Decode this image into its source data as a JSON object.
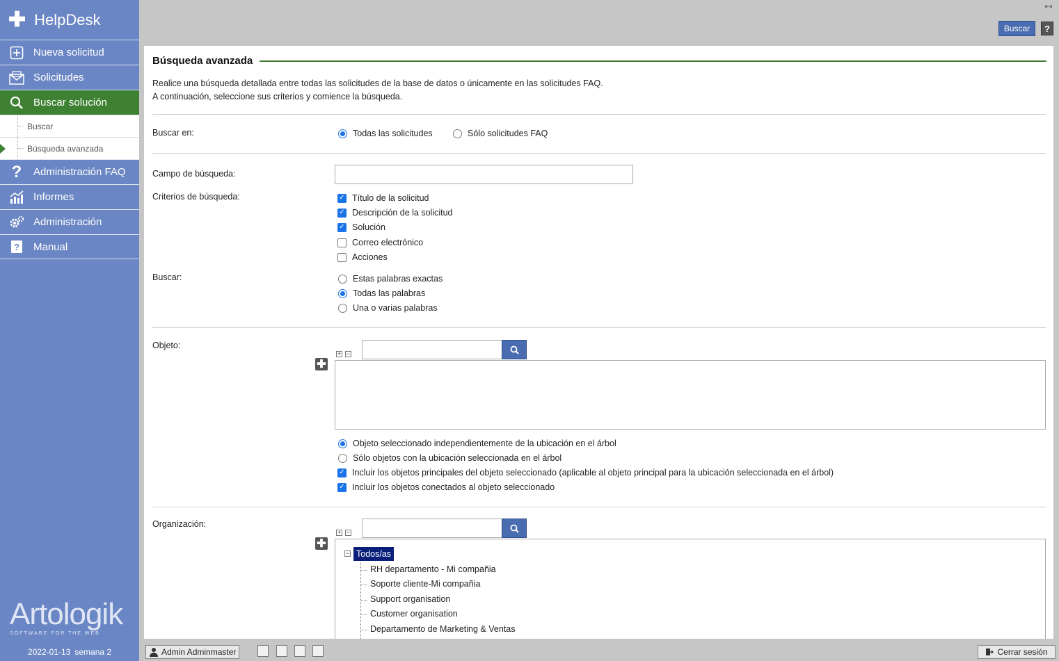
{
  "app": {
    "title": "HelpDesk"
  },
  "sidebar": {
    "items": [
      {
        "label": "Nueva solicitud",
        "icon": "plus-square-icon"
      },
      {
        "label": "Solicitudes",
        "icon": "envelope-icon"
      },
      {
        "label": "Buscar solución",
        "icon": "search-icon",
        "active": true
      },
      {
        "label": "Administración FAQ",
        "icon": "question-icon"
      },
      {
        "label": "Informes",
        "icon": "chart-icon"
      },
      {
        "label": "Administración",
        "icon": "gears-icon"
      },
      {
        "label": "Manual",
        "icon": "manual-icon"
      }
    ],
    "subitems": [
      {
        "label": "Buscar"
      },
      {
        "label": "Búsqueda avanzada",
        "active": true
      }
    ],
    "brand": "Artologik",
    "brand_sub": "SOFTWARE FOR THE WEB",
    "date": "2022-01-13",
    "week": "semana 2"
  },
  "topbar": {
    "search_button": "Buscar",
    "help": "?"
  },
  "page": {
    "title": "Búsqueda avanzada",
    "intro_line1": "Realice una búsqueda detallada entre todas las solicitudes de la base de datos o únicamente en las solicitudes FAQ.",
    "intro_line2": "A continuación, seleccione sus criterios y comience la búsqueda."
  },
  "form": {
    "buscar_en": {
      "label": "Buscar en:",
      "options": [
        "Todas las solicitudes",
        "Sólo solicitudes FAQ"
      ],
      "selected": 0
    },
    "campo": {
      "label": "Campo de búsqueda:",
      "value": "",
      "placeholder": ""
    },
    "criterios": {
      "label": "Criterios de búsqueda:",
      "options": [
        {
          "label": "Título de la solicitud",
          "checked": true
        },
        {
          "label": "Descripción de la solicitud",
          "checked": true
        },
        {
          "label": "Solución",
          "checked": true
        },
        {
          "label": "Correo electrónico",
          "checked": false
        },
        {
          "label": "Acciones",
          "checked": false
        }
      ]
    },
    "buscar": {
      "label": "Buscar:",
      "options": [
        "Estas palabras exactas",
        "Todas las palabras",
        "Una o varias palabras"
      ],
      "selected": 1
    },
    "objeto": {
      "label": "Objeto:",
      "options": [
        {
          "label": "Objeto seleccionado independientemente de la ubicación en el árbol",
          "type": "radio",
          "checked": true
        },
        {
          "label": "Sólo objetos con la ubicación seleccionada en el árbol",
          "type": "radio",
          "checked": false
        },
        {
          "label": "Incluir los objetos principales del objeto seleccionado (aplicable al objeto principal para la ubicación seleccionada en el árbol)",
          "type": "checkbox",
          "checked": true
        },
        {
          "label": "Incluir los objetos conectados al objeto seleccionado",
          "type": "checkbox",
          "checked": true
        }
      ]
    },
    "organizacion": {
      "label": "Organización:",
      "root": "Todos/as",
      "items": [
        "RH departamento - Mi compañia",
        "Soporte cliente-Mi compañia",
        "Support organisation",
        "Customer organisation",
        "Departamento de Marketing & Ventas"
      ]
    }
  },
  "bottombar": {
    "user": "Admin Adminmaster",
    "logout": "Cerrar sesión"
  },
  "colors": {
    "sidebar": "#6b86c4",
    "active": "#3f8132",
    "button": "#4a6cb0",
    "tree_selected": "#0a1f7a"
  }
}
